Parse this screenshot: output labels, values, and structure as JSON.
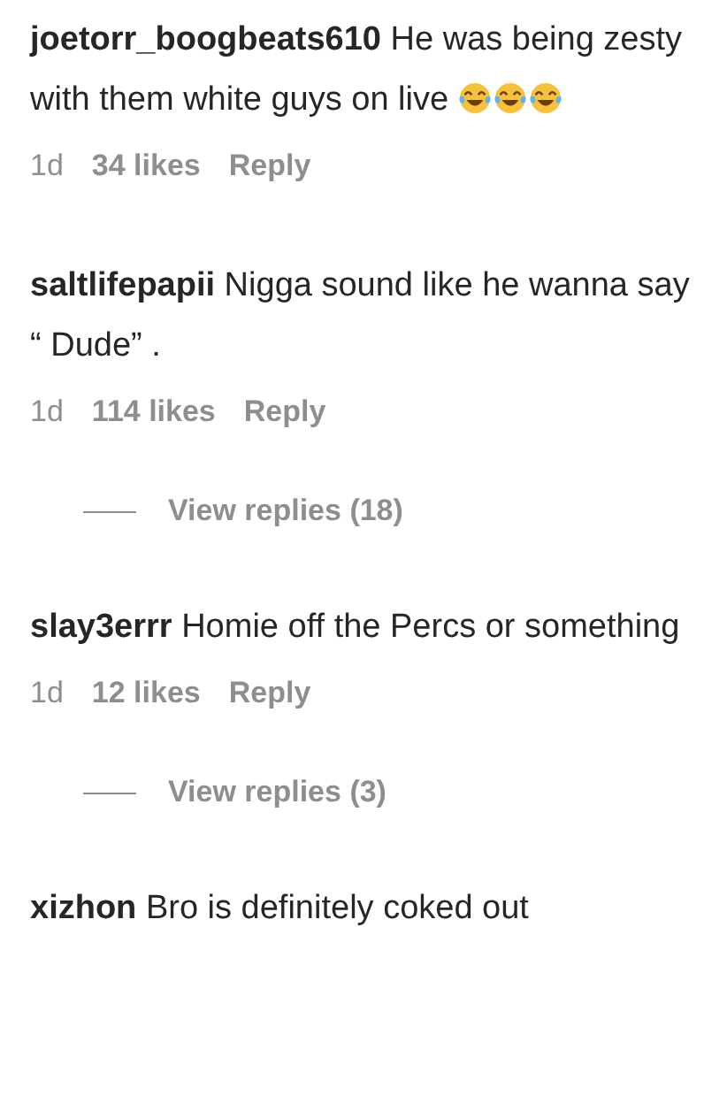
{
  "comments": [
    {
      "username": "joetorr_boogbeats610",
      "text": "He was being zesty with them white guys on live",
      "emojis": [
        {
          "kind": "laughing"
        },
        {
          "kind": "laughing"
        },
        {
          "kind": "laughing"
        }
      ],
      "time": "1d",
      "likes": "34 likes",
      "reply": "Reply"
    },
    {
      "username": "saltlifepapii",
      "text": "Nigga sound like he wanna say “ Dude” .",
      "time": "1d",
      "likes": "114 likes",
      "reply": "Reply",
      "view_replies": "View replies (18)"
    },
    {
      "username": "slay3errr",
      "text": "Homie off the Percs or something",
      "time": "1d",
      "likes": "12 likes",
      "reply": "Reply",
      "view_replies": "View replies (3)"
    },
    {
      "username": "xizhon",
      "text": "Bro is definitely coked out"
    }
  ]
}
